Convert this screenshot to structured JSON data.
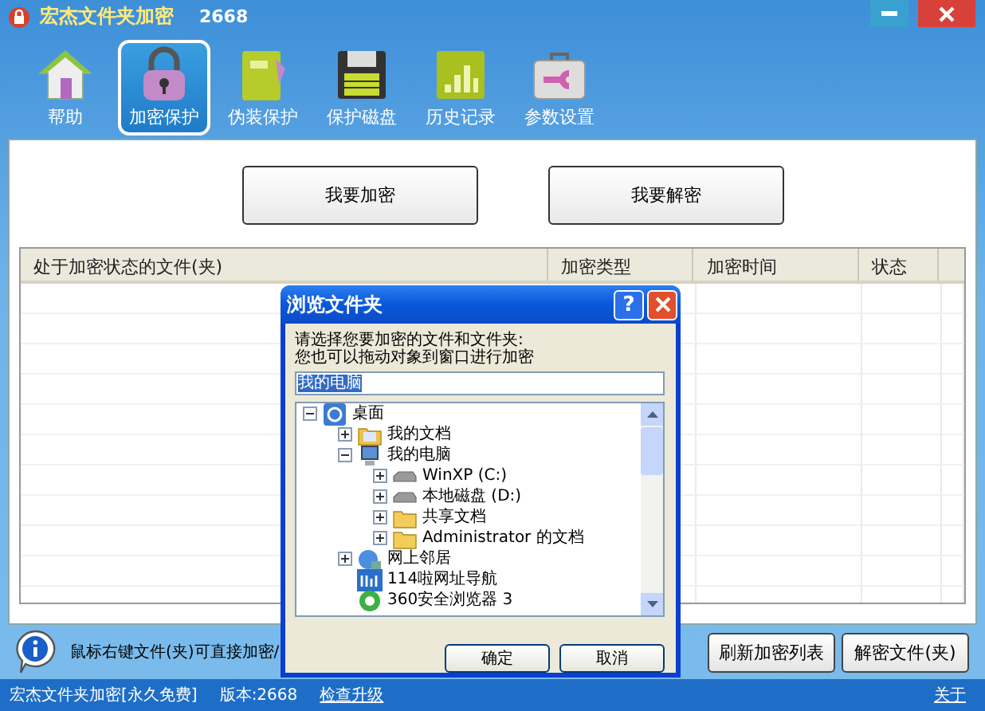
{
  "window": {
    "title": "宏杰文件夹加密",
    "version": "2668"
  },
  "toolbar": [
    {
      "label": "帮助",
      "kind": "home",
      "selected": false
    },
    {
      "label": "加密保护",
      "kind": "lock",
      "selected": true
    },
    {
      "label": "伪装保护",
      "kind": "book",
      "selected": false
    },
    {
      "label": "保护磁盘",
      "kind": "disk",
      "selected": false
    },
    {
      "label": "历史记录",
      "kind": "chart",
      "selected": false
    },
    {
      "label": "参数设置",
      "kind": "toolbox",
      "selected": false
    }
  ],
  "actions": [
    "我要加密",
    "我要解密"
  ],
  "table": {
    "columns": [
      "处于加密状态的文件(夹)",
      "加密类型",
      "加密时间",
      "状态"
    ]
  },
  "hint": "鼠标右键文件(夹)可直接加密/",
  "bottom_buttons": [
    "刷新加密列表",
    "解密文件(夹)"
  ],
  "status_bar": {
    "product": "宏杰文件夹加密[永久免费]",
    "version": "版本:2668",
    "update_link": "检查升级",
    "about_link": "关于"
  },
  "dialog": {
    "title": "浏览文件夹",
    "help": "?",
    "instructions": [
      "请选择您要加密的文件和文件夹:",
      "您也可以拖动对象到窗口进行加密"
    ],
    "path": "我的电脑",
    "tree": [
      {
        "label": "桌面",
        "kind": "desktop",
        "expanded": true,
        "children": [
          {
            "label": "我的文档",
            "kind": "documents",
            "expanded": false
          },
          {
            "label": "我的电脑",
            "kind": "computer",
            "expanded": true,
            "children": [
              {
                "label": "WinXP (C:)",
                "kind": "drive",
                "expanded": false
              },
              {
                "label": "本地磁盘 (D:)",
                "kind": "drive",
                "expanded": false
              },
              {
                "label": "共享文档",
                "kind": "folder",
                "expanded": false
              },
              {
                "label": "Administrator 的文档",
                "kind": "folder",
                "expanded": false
              }
            ]
          },
          {
            "label": "网上邻居",
            "kind": "network",
            "expanded": false
          },
          {
            "label": "114啦网址导航",
            "kind": "web"
          },
          {
            "label": "360安全浏览器 3",
            "kind": "browser"
          }
        ]
      }
    ],
    "buttons": [
      "确定",
      "取消"
    ]
  }
}
